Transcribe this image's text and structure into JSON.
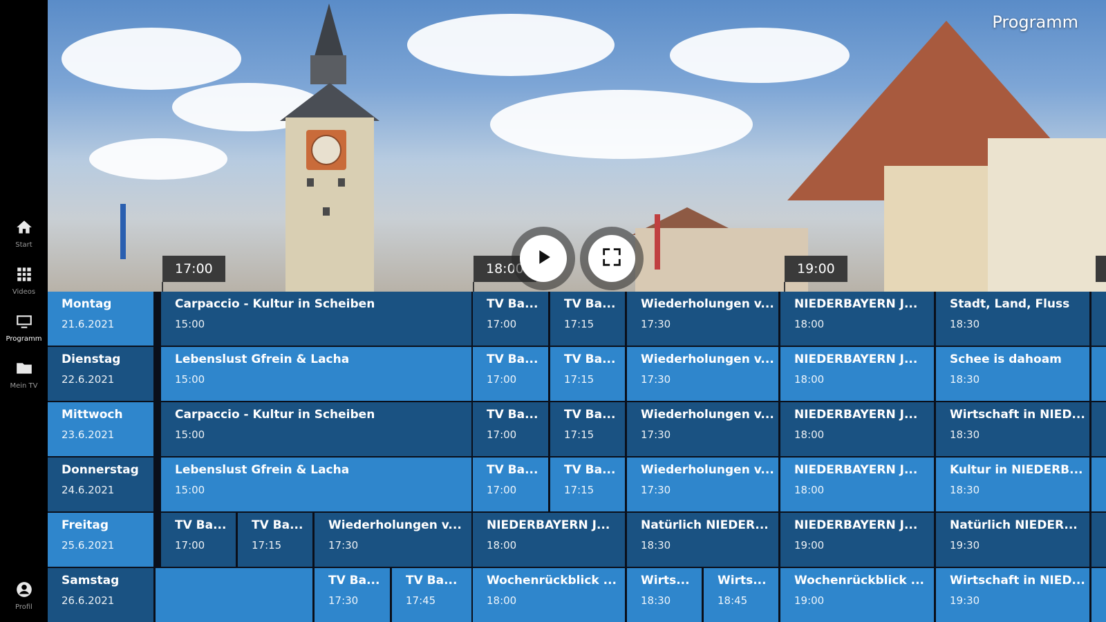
{
  "sidebar": {
    "items": [
      {
        "label": "Start",
        "icon": "home-icon"
      },
      {
        "label": "Videos",
        "icon": "grid-icon"
      },
      {
        "label": "Programm",
        "icon": "tv-icon"
      },
      {
        "label": "Mein TV",
        "icon": "folder-icon"
      },
      {
        "label": "Profil",
        "icon": "profile-icon"
      }
    ]
  },
  "header": {
    "title": "Programm"
  },
  "timeline": {
    "labels": [
      "17:00",
      "18:00",
      "19:00"
    ]
  },
  "player": {
    "play_icon": "play-icon",
    "fullscreen_icon": "fullscreen-icon"
  },
  "colors": {
    "dark_cell": "#1a5282",
    "light_cell": "#2f86cc"
  },
  "schedule": [
    {
      "day": "Montag",
      "date": "21.6.2021",
      "shows": [
        {
          "title": "Carpaccio - Kultur in Scheiben",
          "time": "15:00"
        },
        {
          "title": "TV Ba...",
          "time": "17:00"
        },
        {
          "title": "TV Ba...",
          "time": "17:15"
        },
        {
          "title": "Wiederholungen v...",
          "time": "17:30"
        },
        {
          "title": "NIEDERBAYERN J...",
          "time": "18:00"
        },
        {
          "title": "Stadt, Land, Fluss",
          "time": "18:30"
        }
      ]
    },
    {
      "day": "Dienstag",
      "date": "22.6.2021",
      "shows": [
        {
          "title": "Lebenslust Gfrein & Lacha",
          "time": "15:00"
        },
        {
          "title": "TV Ba...",
          "time": "17:00"
        },
        {
          "title": "TV Ba...",
          "time": "17:15"
        },
        {
          "title": "Wiederholungen v...",
          "time": "17:30"
        },
        {
          "title": "NIEDERBAYERN J...",
          "time": "18:00"
        },
        {
          "title": "Schee is dahoam",
          "time": "18:30"
        }
      ]
    },
    {
      "day": "Mittwoch",
      "date": "23.6.2021",
      "shows": [
        {
          "title": "Carpaccio - Kultur in Scheiben",
          "time": "15:00"
        },
        {
          "title": "TV Ba...",
          "time": "17:00"
        },
        {
          "title": "TV Ba...",
          "time": "17:15"
        },
        {
          "title": "Wiederholungen v...",
          "time": "17:30"
        },
        {
          "title": "NIEDERBAYERN J...",
          "time": "18:00"
        },
        {
          "title": "Wirtschaft in NIED...",
          "time": "18:30"
        }
      ]
    },
    {
      "day": "Donnerstag",
      "date": "24.6.2021",
      "shows": [
        {
          "title": "Lebenslust Gfrein & Lacha",
          "time": "15:00"
        },
        {
          "title": "TV Ba...",
          "time": "17:00"
        },
        {
          "title": "TV Ba...",
          "time": "17:15"
        },
        {
          "title": "Wiederholungen v...",
          "time": "17:30"
        },
        {
          "title": "NIEDERBAYERN J...",
          "time": "18:00"
        },
        {
          "title": "Kultur in NIEDERB...",
          "time": "18:30"
        }
      ]
    },
    {
      "day": "Freitag",
      "date": "25.6.2021",
      "shows": [
        {
          "title": "TV Ba...",
          "time": "17:00"
        },
        {
          "title": "TV Ba...",
          "time": "17:15"
        },
        {
          "title": "Wiederholungen v...",
          "time": "17:30"
        },
        {
          "title": "NIEDERBAYERN J...",
          "time": "18:00"
        },
        {
          "title": "Natürlich NIEDER...",
          "time": "18:30"
        },
        {
          "title": "NIEDERBAYERN J...",
          "time": "19:00"
        },
        {
          "title": "Natürlich NIEDER...",
          "time": "19:30"
        }
      ]
    },
    {
      "day": "Samstag",
      "date": "26.6.2021",
      "shows": [
        {
          "title": "",
          "time": ""
        },
        {
          "title": "TV Ba...",
          "time": "17:30"
        },
        {
          "title": "TV Ba...",
          "time": "17:45"
        },
        {
          "title": "Wochenrückblick ...",
          "time": "18:00"
        },
        {
          "title": "Wirts...",
          "time": "18:30"
        },
        {
          "title": "Wirts...",
          "time": "18:45"
        },
        {
          "title": "Wochenrückblick ...",
          "time": "19:00"
        },
        {
          "title": "Wirtschaft in NIED...",
          "time": "19:30"
        }
      ]
    }
  ]
}
